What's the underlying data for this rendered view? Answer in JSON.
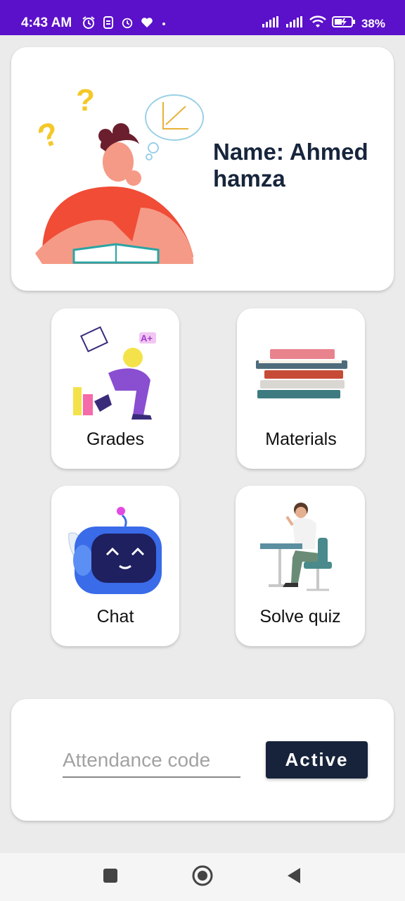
{
  "status_bar": {
    "time": "4:43 AM",
    "battery": "38%",
    "icons": [
      "alarm-icon",
      "notification-icon",
      "alarm-icon",
      "heart-icon",
      "signal-icon",
      "signal-icon",
      "wifi-icon",
      "battery-icon"
    ]
  },
  "profile": {
    "name": "Name: Ahmed hamza"
  },
  "tiles": [
    {
      "label": "Grades",
      "icon": "grades-illustration"
    },
    {
      "label": "Materials",
      "icon": "books-illustration"
    },
    {
      "label": "Chat",
      "icon": "robot-illustration"
    },
    {
      "label": "Solve quiz",
      "icon": "student-desk-illustration"
    }
  ],
  "attendance": {
    "placeholder": "Attendance code",
    "value": "",
    "button_label": "Active"
  },
  "nav": {
    "buttons": [
      "recents-button",
      "home-button",
      "back-button"
    ]
  },
  "colors": {
    "status_bar": "#5b10c9",
    "background": "#ebebeb",
    "accent_dark": "#17233b"
  }
}
